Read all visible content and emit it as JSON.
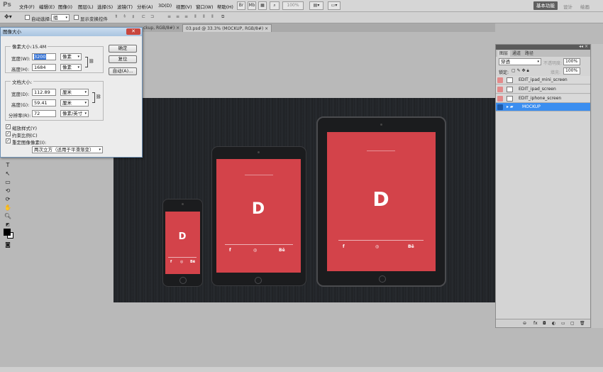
{
  "app": {
    "logo": "Ps"
  },
  "menu": [
    "文件(F)",
    "编辑(E)",
    "图像(I)",
    "图层(L)",
    "选择(S)",
    "滤镜(T)",
    "分析(A)",
    "3D(D)",
    "视图(V)",
    "窗口(W)",
    "帮助(H)"
  ],
  "menu_icons": {
    "zoom_value": "100%"
  },
  "workspace": {
    "active": "基本功能",
    "others": [
      "设计",
      "绘画"
    ]
  },
  "options": {
    "auto_select_label": "自动选择:",
    "auto_select_value": "组",
    "show_transform_label": "显示变换控件"
  },
  "tabs": [
    {
      "label": "ckup, RGB/8#)",
      "active": false
    },
    {
      "label": "03.psd @ 33.3% (MOCKUP, RGB/8#)",
      "active": true
    }
  ],
  "dialog": {
    "title": "图像大小",
    "pixel_dims": "像素大小:15.4M",
    "width_label": "宽度(W):",
    "width_value": "3200",
    "width_unit": "像素",
    "height_label": "高度(H):",
    "height_value": "1684",
    "height_unit": "像素",
    "doc_size": "文档大小:",
    "doc_width_label": "宽度(D):",
    "doc_width_value": "112.89",
    "doc_width_unit": "厘米",
    "doc_height_label": "高度(G):",
    "doc_height_value": "59.41",
    "doc_height_unit": "厘米",
    "resolution_label": "分辨率(R):",
    "resolution_value": "72",
    "resolution_unit": "像素/英寸",
    "scale_styles": "缩放样式(Y)",
    "constrain": "约束比例(C)",
    "resample": "重定图像像素(I):",
    "resample_method": "两次立方（适用于平滑渐变）",
    "ok": "确定",
    "reset": "复位",
    "auto": "自动(A)..."
  },
  "layers_panel": {
    "tabs": [
      "图层",
      "通道",
      "路径"
    ],
    "blend_mode": "穿透",
    "opacity_label": "不透明度:",
    "opacity_value": "100%",
    "lock_label": "锁定:",
    "fill_label": "填充:",
    "fill_value": "100%",
    "layers": [
      {
        "name": "EDIT_ipad_mini_screen",
        "selected": false
      },
      {
        "name": "EDIT_ipad_screen",
        "selected": false
      },
      {
        "name": "EDIT_iphone_screen",
        "selected": false
      },
      {
        "name": "MOCKUP",
        "selected": true
      }
    ]
  },
  "mockup": {
    "logo_glyph": "D",
    "ipad_header": "coming soon",
    "social": [
      "f",
      "◎",
      "Bē"
    ]
  },
  "colors": {
    "accent": "#d3434a",
    "selected_layer": "#3b8ef0",
    "canvas_bg": "#1f2226"
  }
}
